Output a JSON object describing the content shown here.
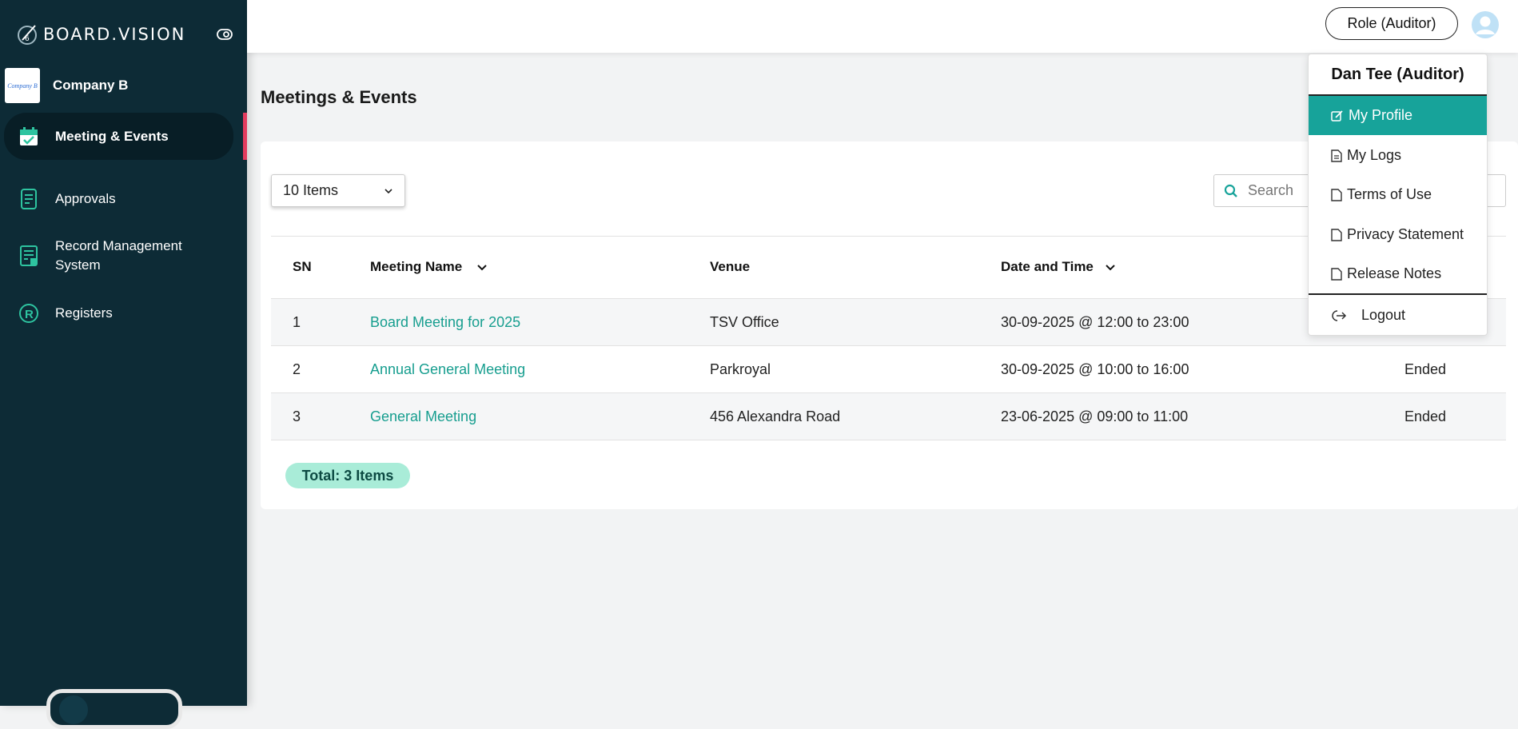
{
  "app": {
    "brand": "BOARD.VISION"
  },
  "company": {
    "name": "Company B",
    "logo_text": "Company B"
  },
  "sidebar": {
    "items": [
      {
        "label": "Meeting & Events",
        "active": true,
        "icon": "calendar-check-icon"
      },
      {
        "label": "Approvals",
        "icon": "document-list-icon"
      },
      {
        "label": "Record Management System",
        "icon": "records-icon"
      },
      {
        "label": "Registers",
        "icon": "registered-icon"
      }
    ]
  },
  "topbar": {
    "role_label": "Role (Auditor)"
  },
  "page": {
    "title": "Meetings & Events"
  },
  "controls": {
    "items_per_page": "10 Items",
    "search_placeholder": "Search"
  },
  "table": {
    "headers": {
      "sn": "SN",
      "name": "Meeting Name",
      "venue": "Venue",
      "datetime": "Date and Time"
    },
    "rows": [
      {
        "sn": "1",
        "name": "Board Meeting for 2025",
        "venue": "TSV Office",
        "datetime": "30-09-2025 @ 12:00 to 23:00",
        "status": ""
      },
      {
        "sn": "2",
        "name": "Annual General Meeting",
        "venue": "Parkroyal",
        "datetime": "30-09-2025 @ 10:00 to 16:00",
        "status": "Ended"
      },
      {
        "sn": "3",
        "name": "General Meeting",
        "venue": "456 Alexandra Road",
        "datetime": "23-06-2025 @ 09:00 to 11:00",
        "status": "Ended"
      }
    ],
    "total": "Total: 3 Items"
  },
  "user_menu": {
    "header": "Dan Tee (Auditor)",
    "items": [
      {
        "label": "My Profile",
        "active": true
      },
      {
        "label": "My Logs"
      },
      {
        "label": "Terms of Use"
      },
      {
        "label": "Privacy Statement"
      },
      {
        "label": "Release Notes"
      }
    ],
    "logout": "Logout"
  },
  "colors": {
    "sidebar_bg": "#0d2b36",
    "accent": "#17a39a",
    "link": "#179e8f",
    "active_marker": "#e33b5e",
    "badge_bg": "#a9ecd8"
  }
}
